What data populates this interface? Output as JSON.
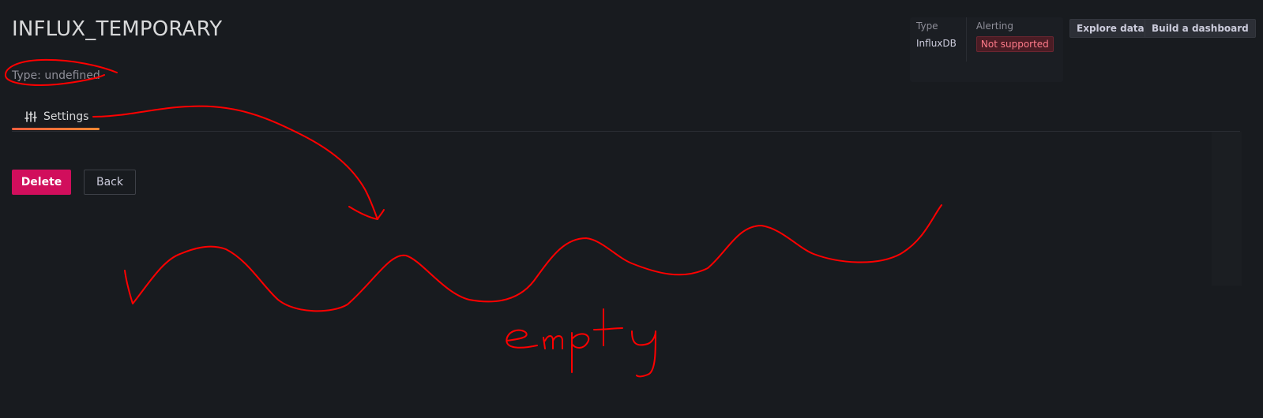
{
  "header": {
    "title": "INFLUX_TEMPORARY",
    "subtitle": "Type: undefined"
  },
  "meta": {
    "type_label": "Type",
    "type_value": "InfluxDB",
    "alerting_label": "Alerting",
    "alerting_value": "Not supported"
  },
  "actions": {
    "explore": "Explore data",
    "dashboard": "Build a dashboard"
  },
  "tabs": [
    {
      "label": "Settings",
      "icon": "sliders-icon",
      "active": true
    }
  ],
  "buttons": {
    "delete": "Delete",
    "back": "Back"
  },
  "annotation": {
    "text": "empty",
    "color": "#ff0000"
  },
  "colors": {
    "background": "#181b1f",
    "accent_tab": "#ff8833",
    "delete_button": "#d10e5c",
    "badge_bg": "#4a1c24",
    "badge_text": "#ff7b8a"
  }
}
